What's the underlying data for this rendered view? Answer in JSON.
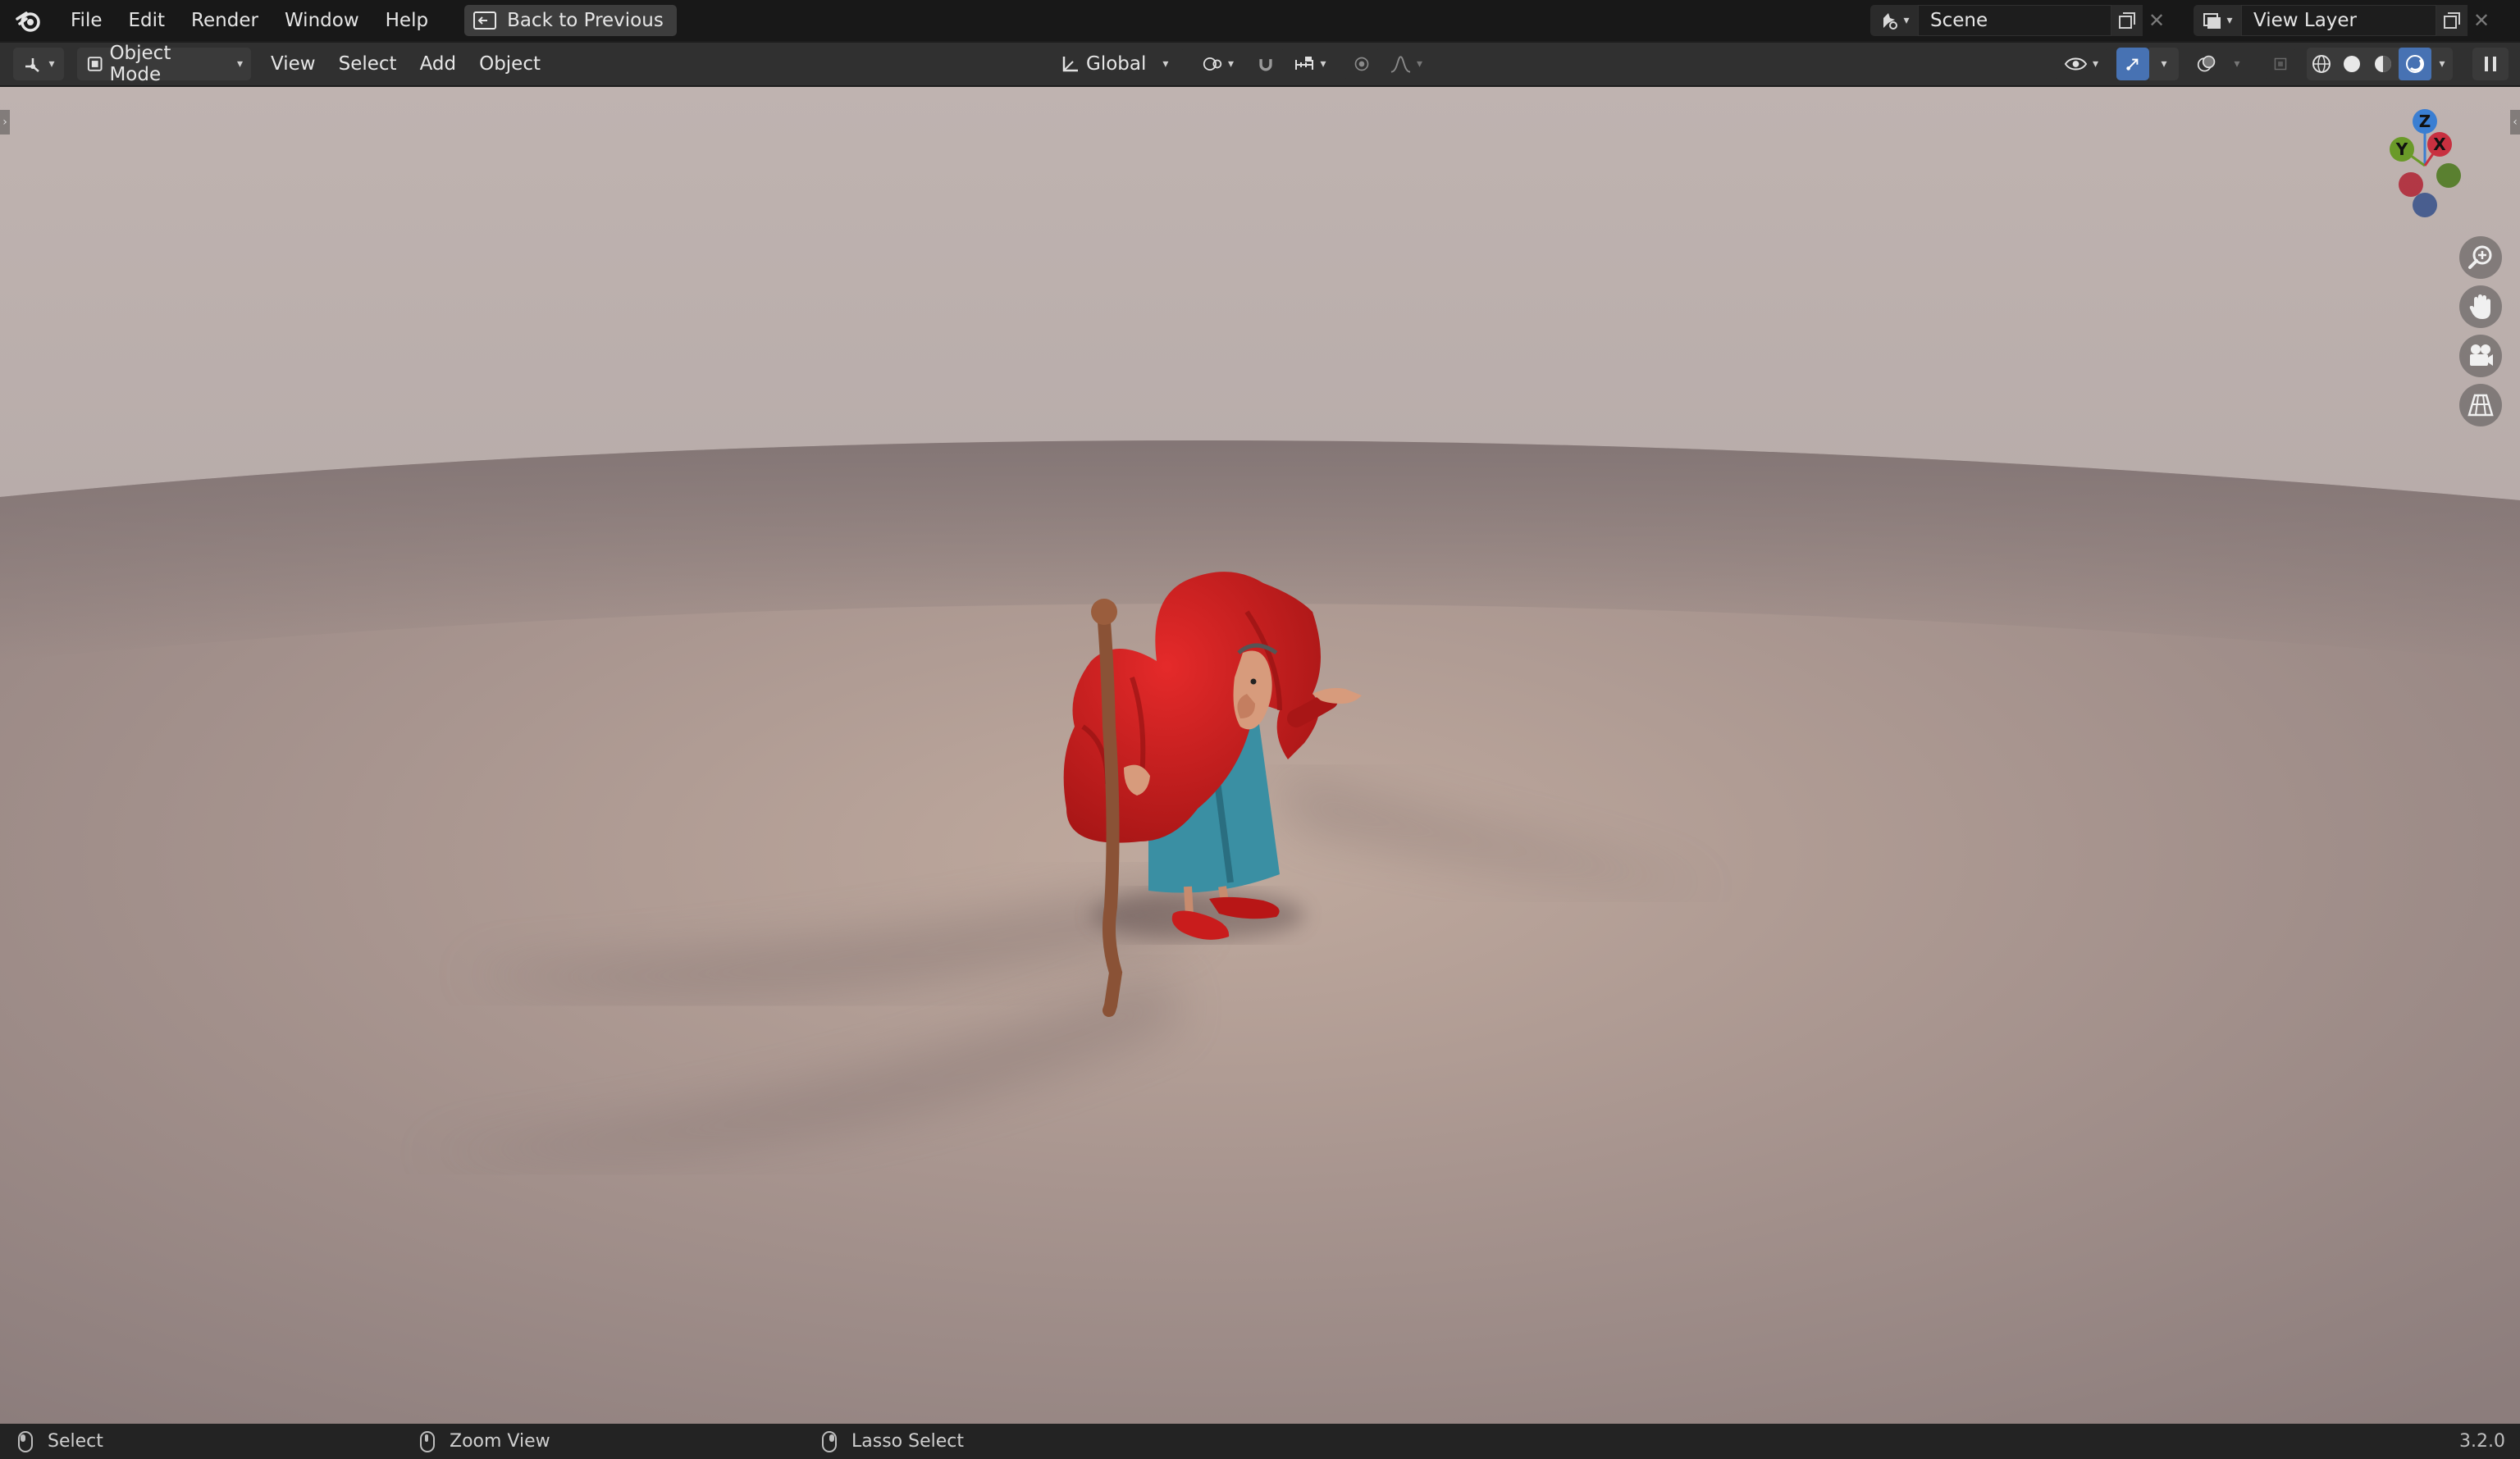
{
  "menubar": {
    "items": [
      "File",
      "Edit",
      "Render",
      "Window",
      "Help"
    ],
    "back_button": "Back to Previous",
    "scene": {
      "name": "Scene"
    },
    "view_layer": {
      "name": "View Layer"
    }
  },
  "header": {
    "mode": "Object Mode",
    "menus": [
      "View",
      "Select",
      "Add",
      "Object"
    ],
    "orientation": "Global"
  },
  "gizmo": {
    "axes": {
      "z": "Z",
      "y": "Y",
      "x": "X"
    }
  },
  "status": {
    "left_click": "Select",
    "middle_click": "Zoom View",
    "right_click": "Lasso Select",
    "version": "3.2.0"
  },
  "colors": {
    "accent": "#4772b3",
    "x_axis": "#c83040",
    "y_axis": "#6a9a28",
    "z_axis": "#3a7ed2"
  }
}
